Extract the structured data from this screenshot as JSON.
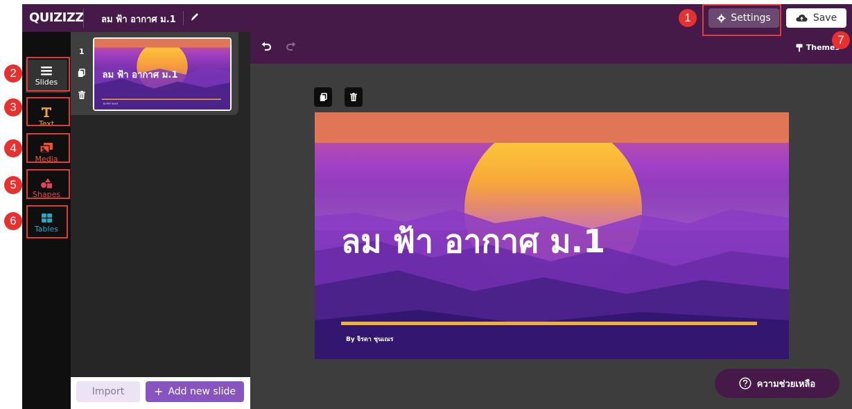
{
  "app": {
    "logo": "QUIZIZZ",
    "quiz_title": "ลม ฟ้า อากาศ ม.1"
  },
  "header": {
    "settings_label": "Settings",
    "save_label": "Save"
  },
  "toolbar": {
    "themes_label": "Themes"
  },
  "sidebar": {
    "items": [
      {
        "label": "Slides",
        "icon": "slides-icon",
        "color": "#ffffff"
      },
      {
        "label": "Text",
        "icon": "text-icon",
        "color": "#f2a22c"
      },
      {
        "label": "Media",
        "icon": "media-icon",
        "color": "#f0502e"
      },
      {
        "label": "Shapes",
        "icon": "shapes-icon",
        "color": "#e0445a"
      },
      {
        "label": "Tables",
        "icon": "table-icon",
        "color": "#2aa8c0"
      }
    ]
  },
  "slides_panel": {
    "slides": [
      {
        "number": "1",
        "title": "ลม ฟ้า อากาศ ม.1",
        "byline": "By จิรดา ชุนเณร"
      }
    ],
    "import_label": "Import",
    "add_label": "Add new slide"
  },
  "canvas": {
    "slide_title": "ลม ฟ้า อากาศ ม.1",
    "byline": "By จิรดา ชุนเณร"
  },
  "help": {
    "label": "ความช่วยเหลือ"
  },
  "annotations": [
    "1",
    "2",
    "3",
    "4",
    "5",
    "6",
    "7"
  ],
  "colors": {
    "header": "#461a48",
    "accent": "#8854c0",
    "annotation": "#e03c3c",
    "slide_band": "#e07656"
  }
}
